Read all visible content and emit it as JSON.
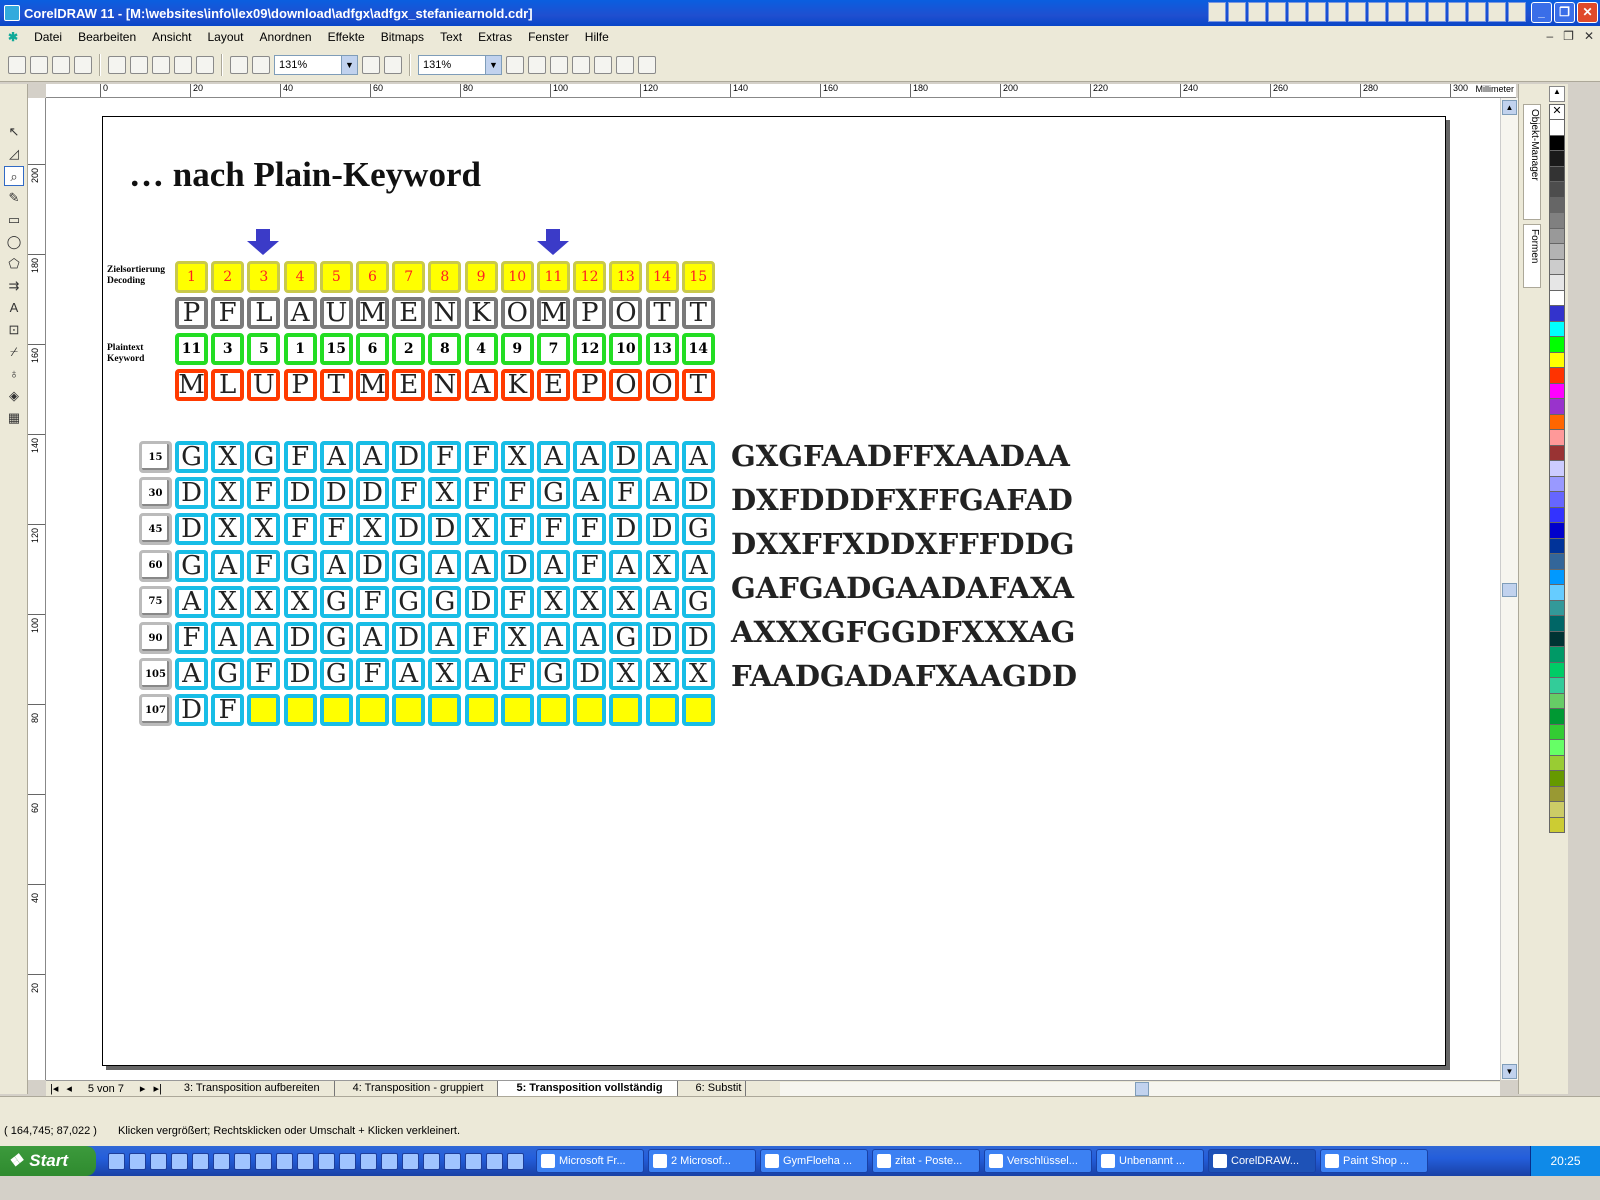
{
  "window": {
    "title": "CorelDRAW 11 - [M:\\websites\\info\\lex09\\download\\adfgx\\adfgx_stefaniearnold.cdr]"
  },
  "menu": [
    "Datei",
    "Bearbeiten",
    "Ansicht",
    "Layout",
    "Anordnen",
    "Effekte",
    "Bitmaps",
    "Text",
    "Extras",
    "Fenster",
    "Hilfe"
  ],
  "toolbar": {
    "zoom1": "131%",
    "zoom2": "131%"
  },
  "ruler": {
    "unit": "Millimeter",
    "h_ticks": [
      "0",
      "20",
      "40",
      "60",
      "80",
      "100",
      "120",
      "140",
      "160",
      "180",
      "200",
      "220",
      "240",
      "260",
      "280",
      "300"
    ],
    "v_ticks": [
      "200",
      "180",
      "160",
      "140",
      "120",
      "100",
      "80",
      "60",
      "40",
      "20"
    ]
  },
  "slide": {
    "heading": "…  nach Plain-Keyword",
    "label_decoding": "Zielsortierung Decoding",
    "label_keyword": "Plaintext Keyword",
    "row_decoding": [
      "1",
      "2",
      "3",
      "4",
      "5",
      "6",
      "7",
      "8",
      "9",
      "10",
      "11",
      "12",
      "13",
      "14",
      "15"
    ],
    "row_plain": [
      "P",
      "F",
      "L",
      "A",
      "U",
      "M",
      "E",
      "N",
      "K",
      "O",
      "M",
      "P",
      "O",
      "T",
      "T"
    ],
    "row_keyword": [
      "11",
      "3",
      "5",
      "1",
      "15",
      "6",
      "2",
      "8",
      "4",
      "9",
      "7",
      "12",
      "10",
      "13",
      "14"
    ],
    "row_sorted": [
      "M",
      "L",
      "U",
      "P",
      "T",
      "M",
      "E",
      "N",
      "A",
      "K",
      "E",
      "P",
      "O",
      "O",
      "T"
    ],
    "grid_numbers": [
      "15",
      "30",
      "45",
      "60",
      "75",
      "90",
      "105",
      "107"
    ],
    "grid_rows": [
      [
        "G",
        "X",
        "G",
        "F",
        "A",
        "A",
        "D",
        "F",
        "F",
        "X",
        "A",
        "A",
        "D",
        "A",
        "A"
      ],
      [
        "D",
        "X",
        "F",
        "D",
        "D",
        "D",
        "F",
        "X",
        "F",
        "F",
        "G",
        "A",
        "F",
        "A",
        "D"
      ],
      [
        "D",
        "X",
        "X",
        "F",
        "F",
        "X",
        "D",
        "D",
        "X",
        "F",
        "F",
        "F",
        "D",
        "D",
        "G"
      ],
      [
        "G",
        "A",
        "F",
        "G",
        "A",
        "D",
        "G",
        "A",
        "A",
        "D",
        "A",
        "F",
        "A",
        "X",
        "A"
      ],
      [
        "A",
        "X",
        "X",
        "X",
        "G",
        "F",
        "G",
        "G",
        "D",
        "F",
        "X",
        "X",
        "X",
        "A",
        "G"
      ],
      [
        "F",
        "A",
        "A",
        "D",
        "G",
        "A",
        "D",
        "A",
        "F",
        "X",
        "A",
        "A",
        "G",
        "D",
        "D"
      ],
      [
        "A",
        "G",
        "F",
        "D",
        "G",
        "F",
        "A",
        "X",
        "A",
        "F",
        "G",
        "D",
        "X",
        "X",
        "X"
      ],
      [
        "D",
        "F",
        "",
        "",
        "",
        "",
        "",
        "",
        "",
        "",
        "",
        "",
        "",
        "",
        ""
      ]
    ],
    "output_lines": [
      "GXGFAADFFXAADAA",
      "DXFDDDFXFFGAFAD",
      "DXXFFXDDXFFFDDG",
      "GAFGADGAADAFAXA",
      "AXXXGFGGDFXXXAG",
      "FAADGADAFXAAGDD"
    ],
    "arrow_columns": [
      3,
      11
    ]
  },
  "dockers": {
    "tab1": "Objekt-Manager",
    "tab2": "Formen"
  },
  "pagebar": {
    "position": "5 von 7",
    "tabs": [
      "3: Transposition aufbereiten",
      "4: Transposition - gruppiert",
      "5: Transposition vollständig",
      "6: Substit"
    ],
    "active": 2
  },
  "status": {
    "coords": "( 164,745; 87,022 )",
    "hint": "Klicken vergrößert; Rechtsklicken oder Umschalt + Klicken verkleinert."
  },
  "taskbar": {
    "start": "Start",
    "tasks": [
      "Microsoft Fr...",
      "2 Microsof...",
      "GymFloeha ...",
      "zitat - Poste...",
      "Verschlüssel...",
      "Unbenannt ...",
      "CorelDRAW...",
      "Paint Shop ..."
    ],
    "active_task": 6,
    "clock": "20:25"
  },
  "palette": [
    "#ffffff",
    "#000000",
    "#1a1a1a",
    "#333333",
    "#4d4d4d",
    "#666666",
    "#808080",
    "#999999",
    "#b3b3b3",
    "#cccccc",
    "#e6e6e6",
    "#ffffff",
    "#3333cc",
    "#00ffff",
    "#00ff00",
    "#ffff00",
    "#ff3300",
    "#ff00ff",
    "#9933cc",
    "#ff6600",
    "#ff9999",
    "#993333",
    "#ccccff",
    "#9999ff",
    "#6666ff",
    "#3333ff",
    "#0000cc",
    "#003399",
    "#336699",
    "#0099ff",
    "#66ccff",
    "#339999",
    "#006666",
    "#003333",
    "#009966",
    "#00cc66",
    "#33cc99",
    "#66cc66",
    "#009933",
    "#33cc33",
    "#66ff66",
    "#99cc33",
    "#669900",
    "#999933",
    "#cccc66",
    "#cccc33"
  ]
}
